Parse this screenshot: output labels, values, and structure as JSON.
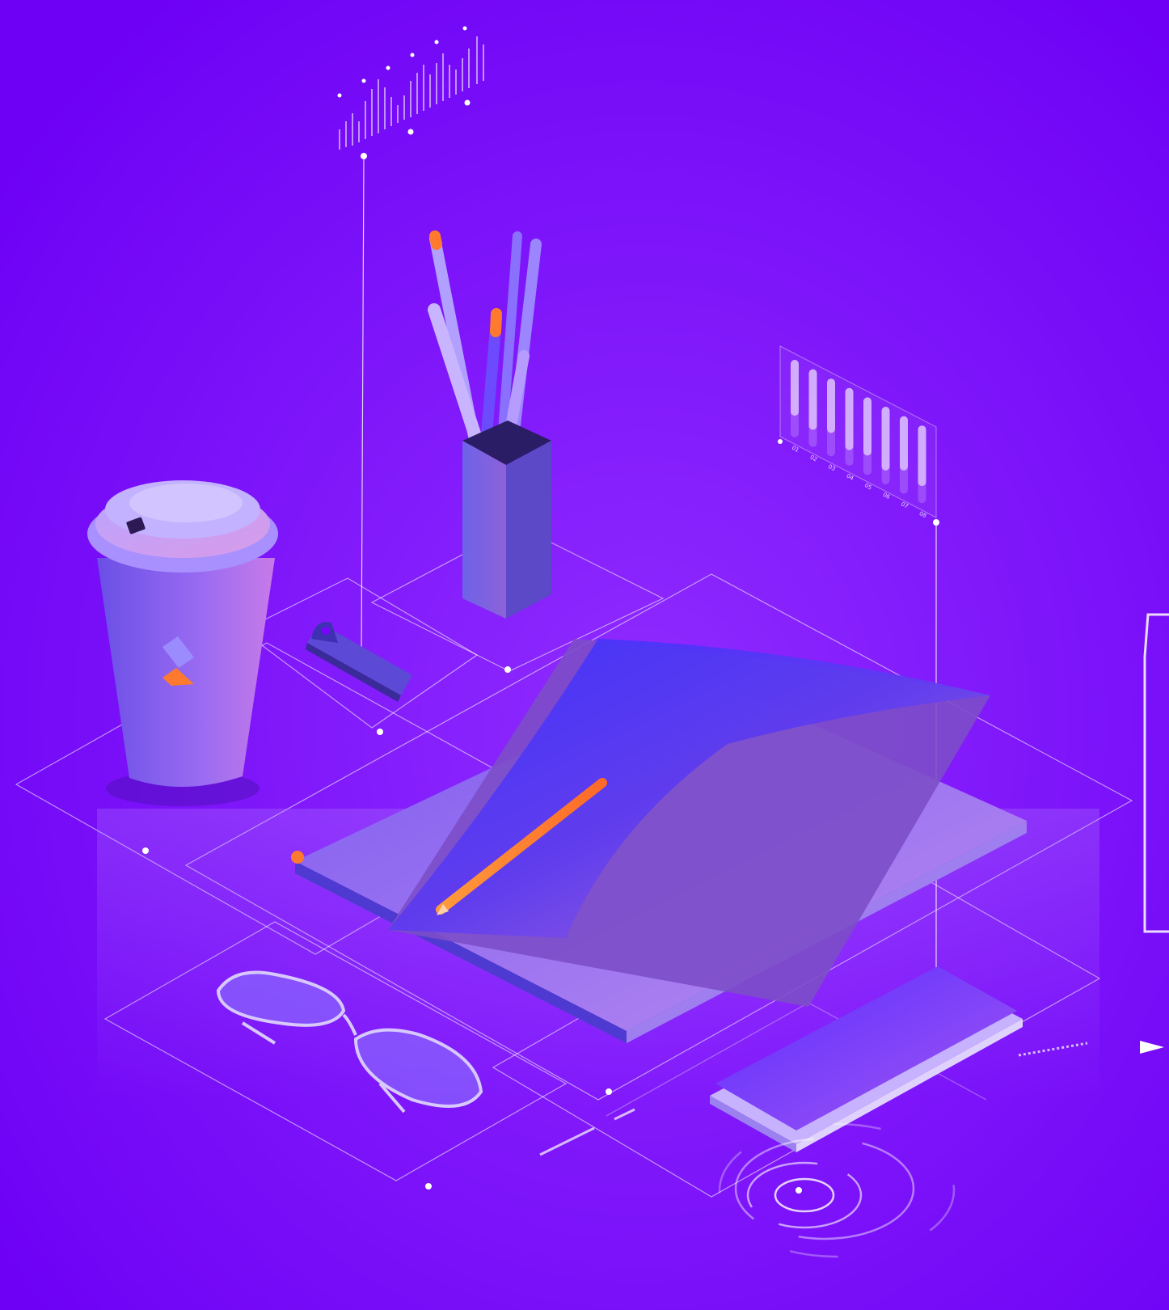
{
  "palette": {
    "background": "#7a00ff",
    "object_purple": "#8a5cf0",
    "accent_orange": "#ff7a2e",
    "grid_line": "#ffffff"
  },
  "hologram_waveform": {
    "tick_labels": [
      "",
      "",
      "",
      "",
      "",
      ""
    ]
  },
  "hologram_bar_panel": {
    "tick_labels": [
      "01",
      "02",
      "03",
      "04",
      "05",
      "06",
      "07",
      "08"
    ],
    "fill_fraction": [
      0.72,
      0.78,
      0.7,
      0.8,
      0.75,
      0.82,
      0.7,
      0.78
    ]
  },
  "cup_logo": "brand-mark-icon",
  "icons": [
    "coffee-cup-icon",
    "pencil-holder-icon",
    "usb-drive-icon",
    "notebook-icon",
    "pencil-icon",
    "glasses-icon",
    "smartphone-icon",
    "target-rings-icon",
    "play-arrow-icon"
  ]
}
